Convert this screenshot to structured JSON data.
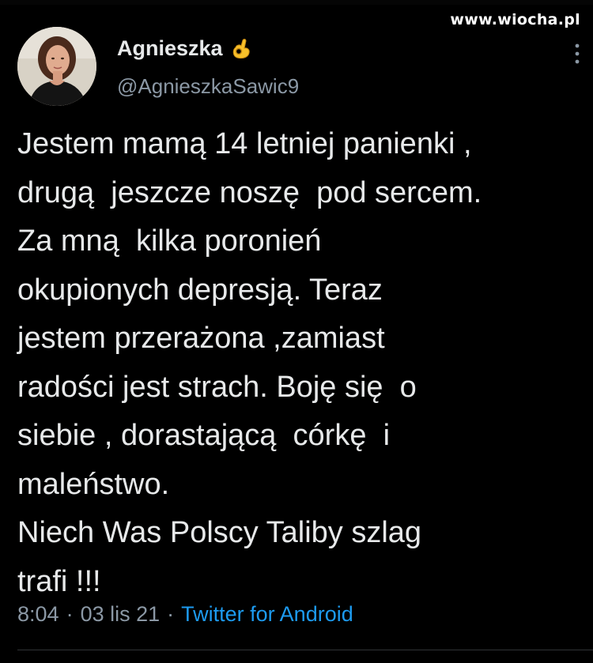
{
  "watermark": "www.wiocha.pl",
  "author": {
    "display_name": "Agnieszka",
    "badge_icon": "ok-hand-emoji",
    "handle": "@AgnieszkaSawic9"
  },
  "tweet": {
    "text": "Jestem mamą 14 letniej panienki ,\ndrugą  jeszcze noszę  pod sercem.\nZa mną  kilka poronień\nokupionych depresją. Teraz\njestem przerażona ,zamiast\nradości jest strach. Boję się  o\nsiebie , dorastającą  córkę  i\nmaleństwo.\nNiech Was Polscy Taliby szlag\ntrafi !!!"
  },
  "meta": {
    "time": "8:04",
    "separator": "·",
    "date": "03 lis 21",
    "source": "Twitter for Android"
  },
  "colors": {
    "background": "#000000",
    "text": "#e7e9ea",
    "secondary": "#8b98a5",
    "link": "#1d9bf0"
  }
}
